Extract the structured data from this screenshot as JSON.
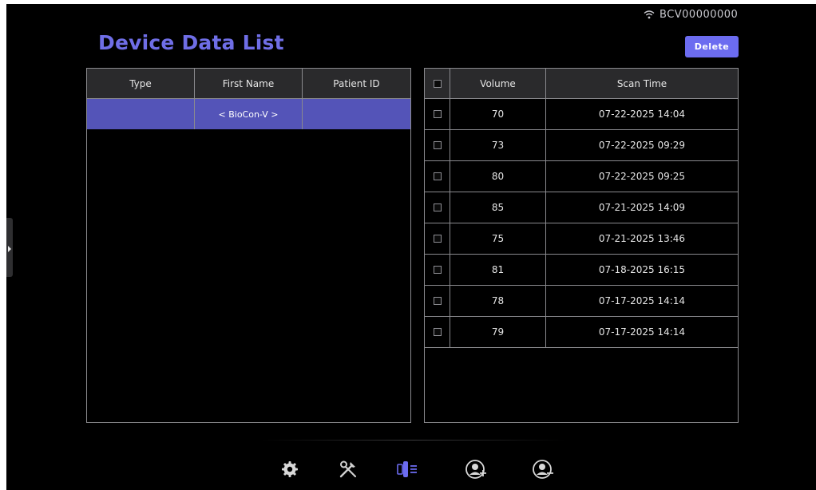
{
  "status": {
    "device_id": "BCV00000000",
    "wifi_icon": "wifi-icon"
  },
  "page": {
    "title": "Device Data List",
    "delete_label": "Delete"
  },
  "left_table": {
    "headers": [
      "Type",
      "First Name",
      "Patient ID"
    ],
    "rows": [
      {
        "type": "",
        "first_name": "< BioCon-V >",
        "patient_id": ""
      }
    ]
  },
  "right_table": {
    "headers": [
      "",
      "Volume",
      "Scan Time"
    ],
    "rows": [
      {
        "volume": "70",
        "scan_time": "07-22-2025 14:04"
      },
      {
        "volume": "73",
        "scan_time": "07-22-2025 09:29"
      },
      {
        "volume": "80",
        "scan_time": "07-22-2025 09:25"
      },
      {
        "volume": "85",
        "scan_time": "07-21-2025 14:09"
      },
      {
        "volume": "75",
        "scan_time": "07-21-2025 13:46"
      },
      {
        "volume": "81",
        "scan_time": "07-18-2025 16:15"
      },
      {
        "volume": "78",
        "scan_time": "07-17-2025 14:14"
      },
      {
        "volume": "79",
        "scan_time": "07-17-2025 14:14"
      }
    ]
  },
  "nav": {
    "items": [
      {
        "icon": "gear-icon"
      },
      {
        "icon": "tools-icon"
      },
      {
        "icon": "device-list-icon",
        "active": true
      },
      {
        "icon": "add-patient-icon"
      },
      {
        "icon": "remove-patient-icon"
      }
    ]
  },
  "colors": {
    "accent": "#6c6cf0",
    "title": "#6f6ee6",
    "selected_row": "#5454b8",
    "background": "#000000"
  }
}
